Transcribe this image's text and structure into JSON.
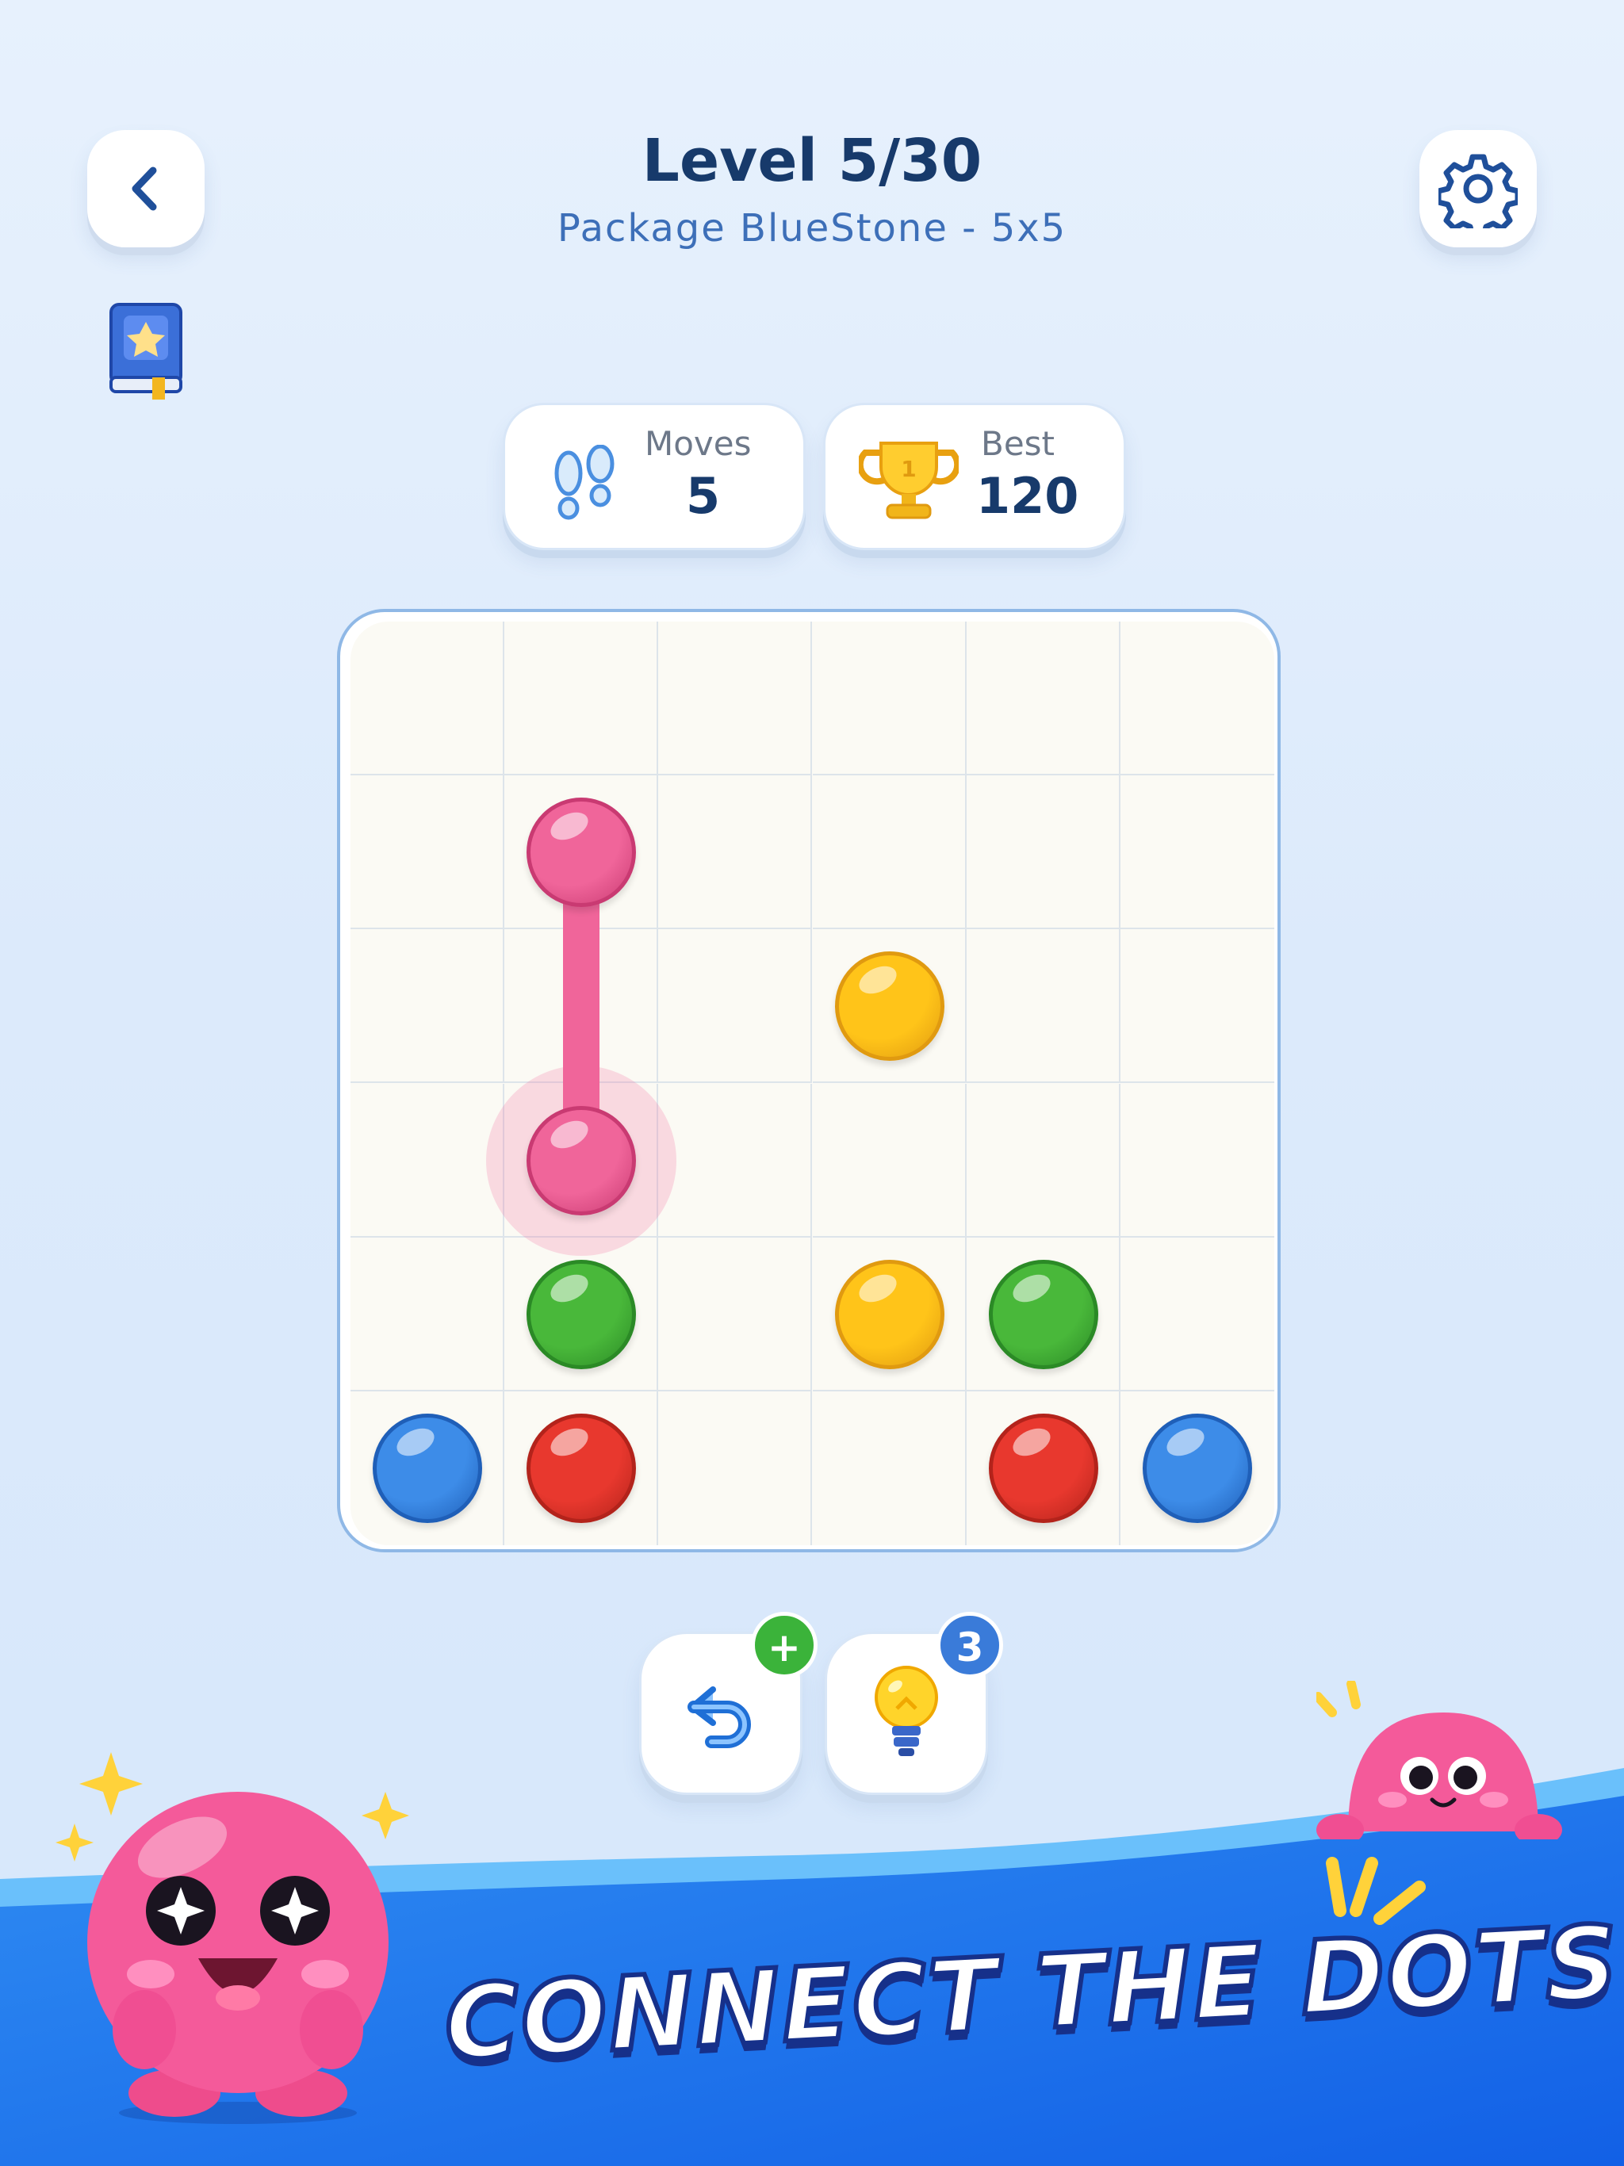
{
  "header": {
    "title": "Level 5/30",
    "subtitle": "Package BlueStone - 5x5"
  },
  "stats": {
    "moves": {
      "label": "Moves",
      "value": "5"
    },
    "best": {
      "label": "Best",
      "value": "120"
    }
  },
  "board": {
    "rows": 6,
    "cols": 6,
    "dots": [
      {
        "row": 1,
        "col": 1,
        "color": "pink"
      },
      {
        "row": 3,
        "col": 1,
        "color": "pink"
      },
      {
        "row": 2,
        "col": 3,
        "color": "yellow"
      },
      {
        "row": 4,
        "col": 1,
        "color": "green"
      },
      {
        "row": 4,
        "col": 3,
        "color": "yellow"
      },
      {
        "row": 4,
        "col": 4,
        "color": "green"
      },
      {
        "row": 5,
        "col": 0,
        "color": "blue"
      },
      {
        "row": 5,
        "col": 1,
        "color": "red"
      },
      {
        "row": 5,
        "col": 4,
        "color": "red"
      },
      {
        "row": 5,
        "col": 5,
        "color": "blue"
      }
    ],
    "path": {
      "color": "pink",
      "from": [
        1,
        1
      ],
      "to": [
        3,
        1
      ]
    },
    "selected": [
      3,
      1
    ]
  },
  "colors": {
    "pink": "#f0659a",
    "yellow": "#ffc419",
    "green": "#49b83a",
    "blue": "#3d8ce8",
    "red": "#e8382e",
    "accent": "#173a6b"
  },
  "tools": {
    "undo_badge": "+",
    "hint_badge": "3"
  },
  "banner": {
    "text": "CONNECT THE DOTS"
  }
}
